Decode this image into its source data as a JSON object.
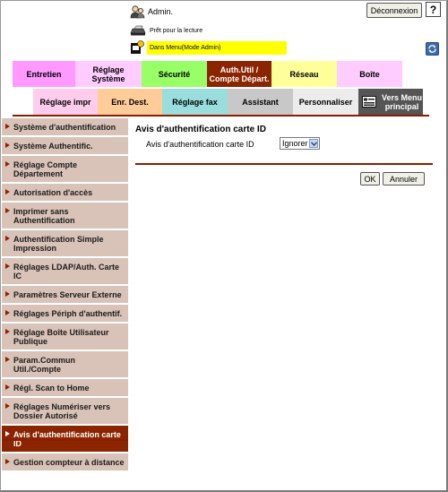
{
  "header": {
    "user_label": "Admin.",
    "logout_label": "Déconnexion",
    "help_label": "?",
    "status_text": "Prêt pour la lecture",
    "mode_text": "Dans Menu(Mode Admin)"
  },
  "tabs_row1": [
    {
      "label": "Entretien",
      "color": "#ff99ff"
    },
    {
      "label": "Réglage Système",
      "color": "#ffccff"
    },
    {
      "label": "Sécurité",
      "color": "#99ff66"
    },
    {
      "label": "Auth.Util / Compte Départ.",
      "color": "#8b2500",
      "active": true
    },
    {
      "label": "Réseau",
      "color": "#ffff99"
    },
    {
      "label": "Boîte",
      "color": "#ffccff"
    }
  ],
  "tabs_row2": [
    {
      "label": "Réglage impr",
      "color": "#ffccee"
    },
    {
      "label": "Enr. Dest.",
      "color": "#ffcc99"
    },
    {
      "label": "Réglage fax",
      "color": "#99dddd"
    },
    {
      "label": "Assistant",
      "color": "#c8c8c8"
    },
    {
      "label": "Personnaliser",
      "color": "#ececec"
    },
    {
      "label": "Vers Menu principal",
      "color": "#555555"
    }
  ],
  "sidebar": {
    "items": [
      {
        "label": "Système d'authentification"
      },
      {
        "label": "Système Authentific."
      },
      {
        "label": "Réglage Compte Département"
      },
      {
        "label": "Autorisation d'accès"
      },
      {
        "label": "Imprimer sans Authentification"
      },
      {
        "label": "Authentification Simple Impression"
      },
      {
        "label": "Réglages LDAP/Auth. Carte IC"
      },
      {
        "label": "Paramètres Serveur Externe"
      },
      {
        "label": "Réglages Périph d'authentif."
      },
      {
        "label": "Réglage Boîte Utilisateur Publique"
      },
      {
        "label": "Param.Commun Util./Compte"
      },
      {
        "label": "Régl. Scan to Home"
      },
      {
        "label": "Réglages Numériser vers Dossier Autorisé"
      },
      {
        "label": "Avis d'authentification carte ID",
        "active": true
      },
      {
        "label": "Gestion compteur à distance"
      }
    ]
  },
  "main": {
    "title": "Avis d'authentification carte ID",
    "field_label": "Avis d'authentification carte ID",
    "field_value": "Ignorer",
    "ok_label": "OK",
    "cancel_label": "Annuler"
  },
  "colors": {
    "accent": "#8b2500",
    "sidebar_bg": "#d9c3b8",
    "mode_bar": "#ffff00"
  }
}
